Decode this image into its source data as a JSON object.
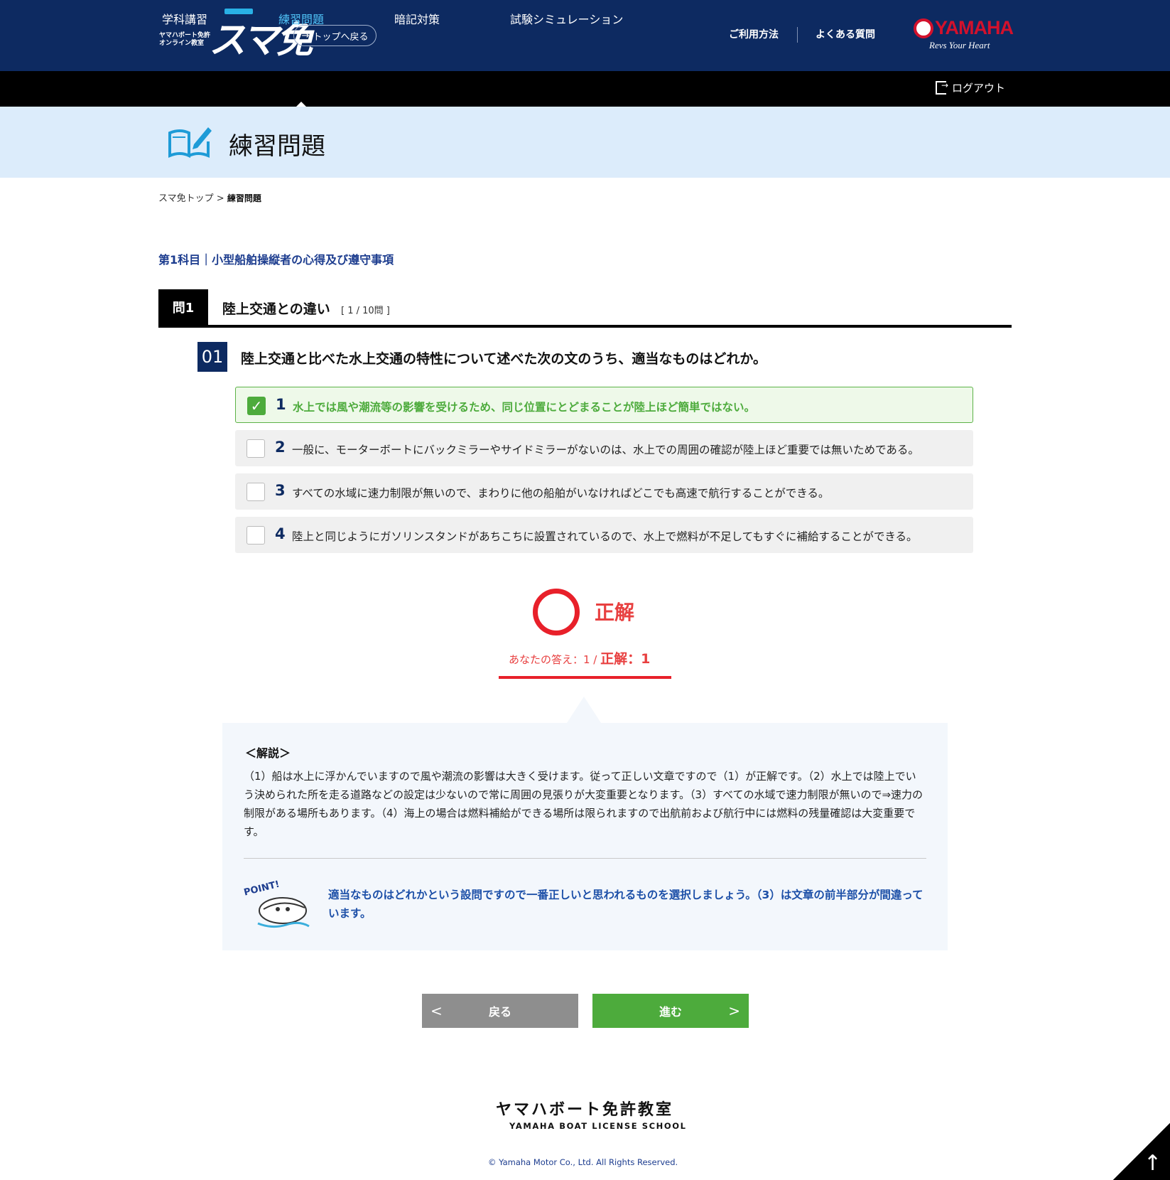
{
  "header": {
    "logo_small_line1": "ヤマハボート免許",
    "logo_small_line2": "オンライン教室",
    "logo_big": "スマ免",
    "back_to_top": "トップへ戻る",
    "link_usage": "ご利用方法",
    "link_faq": "よくある質問",
    "brand": "YAMAHA",
    "brand_tagline": "Revs Your Heart"
  },
  "nav": {
    "items": [
      {
        "label": "学科講習"
      },
      {
        "label": "練習問題"
      },
      {
        "label": "暗記対策"
      },
      {
        "label": "試験シミュレーション"
      }
    ],
    "active_index": 1,
    "logout": "ログアウト"
  },
  "page": {
    "title": "練習問題",
    "breadcrumb_home": "スマ免トップ",
    "breadcrumb_sep": ">",
    "breadcrumb_current": "練習問題",
    "subject": "第1科目｜小型船舶操縦者の心得及び遵守事項"
  },
  "question": {
    "head_label": "問1",
    "head_title": "陸上交通との違い",
    "count": "[ 1 / 10問 ]",
    "number": "01",
    "text": "陸上交通と比べた水上交通の特性について述べた次の文のうち、適当なものはどれか。",
    "options": [
      {
        "no": "1",
        "text": "水上では風や潮流等の影響を受けるため、同じ位置にとどまることが陸上ほど簡単ではない。",
        "selected": true
      },
      {
        "no": "2",
        "text": "一般に、モーターボートにバックミラーやサイドミラーがないのは、水上での周囲の確認が陸上ほど重要では無いためである。",
        "selected": false
      },
      {
        "no": "3",
        "text": "すべての水域に速力制限が無いので、まわりに他の船舶がいなければどこでも高速で航行することができる。",
        "selected": false
      },
      {
        "no": "4",
        "text": "陸上と同じようにガソリンスタンドがあちこちに設置されているので、水上で燃料が不足してもすぐに補給することができる。",
        "selected": false
      }
    ]
  },
  "result": {
    "label": "正解",
    "your_answer": "あなたの答え：1 /",
    "correct_answer": "正解：1"
  },
  "explanation": {
    "heading": "＜解説＞",
    "body": "（1）船は水上に浮かんでいますので風や潮流の影響は大きく受けます。従って正しい文章ですので（1）が正解です。（2）水上では陸上でいう決められた所を走る道路などの設定は少ないので常に周囲の見張りが大変重要となります。（3）すべての水域で速力制限が無いので⇒速力の制限がある場所もあります。（4）海上の場合は燃料補給ができる場所は限られますので出航前および航行中には燃料の残量確認は大変重要です。",
    "point_badge": "POINT!",
    "point": "適当なものはどれかという設問ですので一番正しいと思われるものを選択しましょう。（3）は文章の前半部分が間違っています。"
  },
  "buttons": {
    "back": "戻る",
    "next": "進む"
  },
  "footer": {
    "school_ja": "ヤマハボート免許教室",
    "school_en": "YAMAHA BOAT LICENSE SCHOOL",
    "copyright": "© Yamaha Motor Co., Ltd. All Rights Reserved."
  },
  "colors": {
    "navy": "#0d2a61",
    "green": "#4dab3c",
    "red": "#e8202a",
    "light_blue": "#dcecfb"
  }
}
